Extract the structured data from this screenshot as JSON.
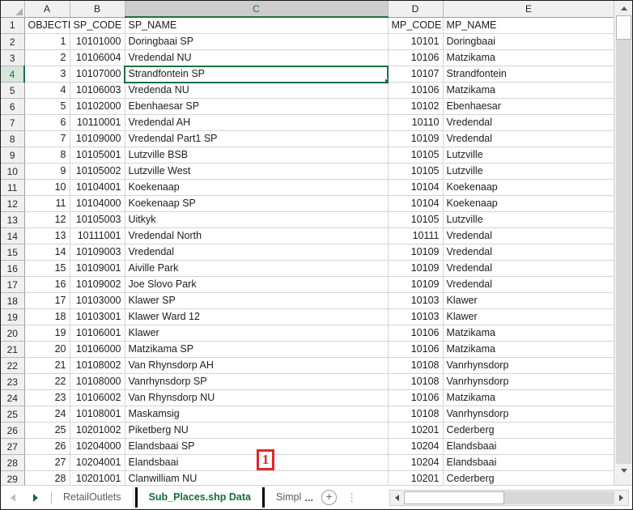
{
  "grid": {
    "column_headers": [
      "A",
      "B",
      "C",
      "D",
      "E"
    ],
    "selected_column": "C",
    "selected_row": "4",
    "active_cell": "C4",
    "header_row": {
      "row_number": "1",
      "a": "OBJECTID",
      "b": "SP_CODE",
      "c": "SP_NAME",
      "d": "MP_CODE",
      "e": "MP_NAME"
    },
    "rows": [
      {
        "n": "2",
        "a": "1",
        "b": "10101000",
        "c": "Doringbaai SP",
        "d": "10101",
        "e": "Doringbaai"
      },
      {
        "n": "3",
        "a": "2",
        "b": "10106004",
        "c": "Vredendal NU",
        "d": "10106",
        "e": "Matzikama"
      },
      {
        "n": "4",
        "a": "3",
        "b": "10107000",
        "c": "Strandfontein SP",
        "d": "10107",
        "e": "Strandfontein"
      },
      {
        "n": "5",
        "a": "4",
        "b": "10106003",
        "c": "Vredenda  NU",
        "d": "10106",
        "e": "Matzikama"
      },
      {
        "n": "6",
        "a": "5",
        "b": "10102000",
        "c": "Ebenhaesar SP",
        "d": "10102",
        "e": "Ebenhaesar"
      },
      {
        "n": "7",
        "a": "6",
        "b": "10110001",
        "c": "Vredendal AH",
        "d": "10110",
        "e": "Vredendal"
      },
      {
        "n": "8",
        "a": "7",
        "b": "10109000",
        "c": "Vredendal Part1 SP",
        "d": "10109",
        "e": "Vredendal"
      },
      {
        "n": "9",
        "a": "8",
        "b": "10105001",
        "c": "Lutzville BSB",
        "d": "10105",
        "e": "Lutzville"
      },
      {
        "n": "10",
        "a": "9",
        "b": "10105002",
        "c": "Lutzville West",
        "d": "10105",
        "e": "Lutzville"
      },
      {
        "n": "11",
        "a": "10",
        "b": "10104001",
        "c": "Koekenaap",
        "d": "10104",
        "e": "Koekenaap"
      },
      {
        "n": "12",
        "a": "11",
        "b": "10104000",
        "c": "Koekenaap SP",
        "d": "10104",
        "e": "Koekenaap"
      },
      {
        "n": "13",
        "a": "12",
        "b": "10105003",
        "c": "Uitkyk",
        "d": "10105",
        "e": "Lutzville"
      },
      {
        "n": "14",
        "a": "13",
        "b": "10111001",
        "c": "Vredendal North",
        "d": "10111",
        "e": "Vredendal"
      },
      {
        "n": "15",
        "a": "14",
        "b": "10109003",
        "c": "Vredendal",
        "d": "10109",
        "e": "Vredendal"
      },
      {
        "n": "16",
        "a": "15",
        "b": "10109001",
        "c": "Aiville Park",
        "d": "10109",
        "e": "Vredendal"
      },
      {
        "n": "17",
        "a": "16",
        "b": "10109002",
        "c": "Joe Slovo Park",
        "d": "10109",
        "e": "Vredendal"
      },
      {
        "n": "18",
        "a": "17",
        "b": "10103000",
        "c": "Klawer SP",
        "d": "10103",
        "e": "Klawer"
      },
      {
        "n": "19",
        "a": "18",
        "b": "10103001",
        "c": "Klawer Ward 12",
        "d": "10103",
        "e": "Klawer"
      },
      {
        "n": "20",
        "a": "19",
        "b": "10106001",
        "c": "Klawer",
        "d": "10106",
        "e": "Matzikama"
      },
      {
        "n": "21",
        "a": "20",
        "b": "10106000",
        "c": "Matzikama SP",
        "d": "10106",
        "e": "Matzikama"
      },
      {
        "n": "22",
        "a": "21",
        "b": "10108002",
        "c": "Van Rhynsdorp AH",
        "d": "10108",
        "e": "Vanrhynsdorp"
      },
      {
        "n": "23",
        "a": "22",
        "b": "10108000",
        "c": "Vanrhynsdorp SP",
        "d": "10108",
        "e": "Vanrhynsdorp"
      },
      {
        "n": "24",
        "a": "23",
        "b": "10106002",
        "c": "Van Rhynsdorp NU",
        "d": "10106",
        "e": "Matzikama"
      },
      {
        "n": "25",
        "a": "24",
        "b": "10108001",
        "c": "Maskamsig",
        "d": "10108",
        "e": "Vanrhynsdorp"
      },
      {
        "n": "26",
        "a": "25",
        "b": "10201002",
        "c": "Piketberg NU",
        "d": "10201",
        "e": "Cederberg"
      },
      {
        "n": "27",
        "a": "26",
        "b": "10204000",
        "c": "Elandsbaai SP",
        "d": "10204",
        "e": "Elandsbaai"
      },
      {
        "n": "28",
        "a": "27",
        "b": "10204001",
        "c": "Elandsbaai",
        "d": "10204",
        "e": "Elandsbaai"
      },
      {
        "n": "29",
        "a": "28",
        "b": "10201001",
        "c": "Clanwilliam NU",
        "d": "10201",
        "e": "Cederberg"
      }
    ]
  },
  "annotation": {
    "badge_label": "1"
  },
  "sheet_tabs": {
    "nav_prev_icon": "triangle-left-icon",
    "nav_next_icon": "triangle-right-icon",
    "tabs": [
      {
        "label": "RetailOutlets",
        "active": false
      },
      {
        "label": "Sub_Places.shp Data",
        "active": true
      },
      {
        "label": "Simpl",
        "active": false
      }
    ],
    "truncated_indicator": "...",
    "add_sheet_icon": "plus-circle-icon",
    "overflow_icon": "kebab-menu-icon"
  },
  "scrollbars": {
    "vertical": {
      "up_icon": "scroll-up-icon",
      "down_icon": "scroll-down-icon"
    },
    "horizontal": {
      "left_icon": "scroll-left-icon",
      "right_icon": "scroll-right-icon"
    }
  },
  "colors": {
    "accent_green": "#1d6f42",
    "annotation_red": "#e52528",
    "header_gray": "#f0f0f0",
    "gridline": "#d4d4d4"
  }
}
